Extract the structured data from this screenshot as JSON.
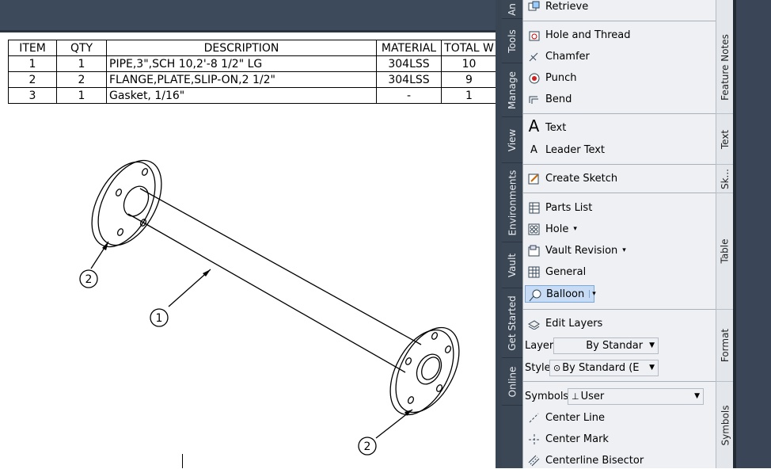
{
  "bom": {
    "headers": [
      "ITEM",
      "QTY",
      "DESCRIPTION",
      "MATERIAL",
      "TOTAL W"
    ],
    "rows": [
      [
        "1",
        "1",
        "PIPE,3\",SCH 10,2'-8 1/2\" LG",
        "304LSS",
        "10"
      ],
      [
        "2",
        "2",
        "FLANGE,PLATE,SLIP-ON,2 1/2\"",
        "304LSS",
        "9"
      ],
      [
        "3",
        "1",
        "Gasket, 1/16\"",
        "-",
        "1"
      ]
    ]
  },
  "balloons": [
    "2",
    "1",
    "2"
  ],
  "palette": {
    "vertical_tabs": [
      "An",
      "Tools",
      "Manage",
      "View",
      "Environments",
      "Vault",
      "Get Started",
      "Online"
    ],
    "group_labels": [
      "Feature Notes",
      "Text",
      "Sk...",
      "Table",
      "Format",
      "Symbols"
    ],
    "items": {
      "retrieve": "Retrieve",
      "hole_thread": "Hole and Thread",
      "chamfer": "Chamfer",
      "punch": "Punch",
      "bend": "Bend",
      "text": "Text",
      "leader_text": "Leader Text",
      "create_sketch": "Create Sketch",
      "parts_list": "Parts List",
      "hole": "Hole",
      "vault_revision": "Vault Revision",
      "general": "General",
      "balloon": "Balloon",
      "edit_layers": "Edit Layers",
      "center_line": "Center Line",
      "center_mark": "Center Mark",
      "centerline_bisector": "Centerline Bisector"
    },
    "format": {
      "layer_label": "Layer",
      "layer_value": "By Standar",
      "style_label": "Style",
      "style_value": "By Standard (E",
      "symbols_label": "Symbols",
      "symbols_value": "User"
    },
    "text_icon_glyph": "A",
    "leader_icon_glyph": "A"
  }
}
